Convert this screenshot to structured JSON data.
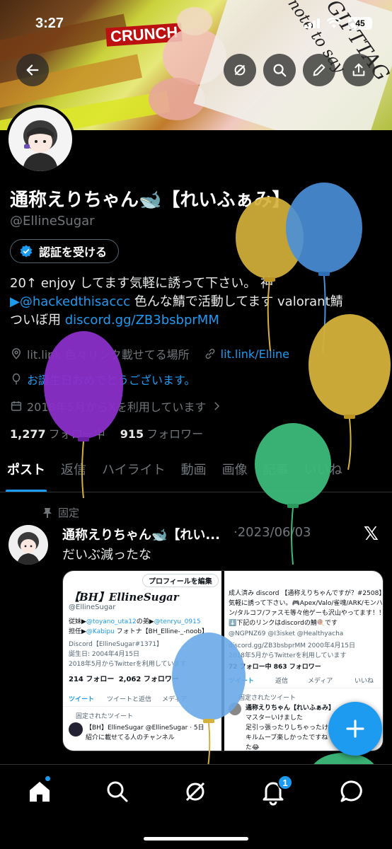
{
  "status_bar": {
    "time": "3:27",
    "battery": "45"
  },
  "profile": {
    "display_name": "通称えりちゃん🐋【れいふぁみ】",
    "handle": "@EllineSugar",
    "verify_button": "認証を受ける",
    "bio_line1": "20↑ enjoy してます気軽に誘って下さい。 神",
    "bio_line2_link": "▶@hackedthisaccc",
    "bio_line2_text": " 色んな鯖で活動してます valorant鯖",
    "bio_line3_text": "ついぼ用 ",
    "bio_line3_link": "discord.gg/ZB3bsbprMM",
    "location": "lit.link 色々リンク載せてる場所",
    "website": "lit.link/Elline",
    "birthday": "お誕生日おめでとうございます。",
    "joined": "2018年5月からXを利用しています",
    "following_count": "1,277",
    "following_label": "フォロー中",
    "followers_count": "915",
    "followers_label": "フォロワー"
  },
  "tabs": [
    "ポスト",
    "返信",
    "ハイライト",
    "動画",
    "画像",
    "記事",
    "いいね"
  ],
  "pinned_tweet": {
    "pinned_label": "固定",
    "author": "通称えりちゃん🐋【れい...",
    "date": "·2023/06/03",
    "text": "だいぶ減ったな",
    "left_shot": {
      "edit_button": "プロフィールを編集",
      "name": "【BH】EllineSugar",
      "handle": "@EllineSugar",
      "line1a": "従妹▶",
      "line1b": "@toyano_uta12",
      "line1c": "の弟▶",
      "line1d": "@tenryu_0915",
      "line2a": "担任▶",
      "line2b": "@Kabipu",
      "line2c": " フォトナ【BH_Elline-_-noob】",
      "line3": "Discord【EllineSugar#1371】",
      "line4": "誕生日: 2004年4月15日",
      "line5": "2018年5月からTwitterを利用しています",
      "following": "214 フォロー",
      "followers": "2,062 フォロワー",
      "tab1": "ツイート",
      "tab2": "ツイートと返信",
      "tab3": "メディア",
      "pinned": "固定されたツイート",
      "tweet_author": "【BH】EllineSugar @EllineSugar · 5日",
      "tweet_text": "紹介に載せてる人のチャンネル"
    },
    "right_shot": {
      "line1": "成人済み discord 【通称えりちゃんですが？#2508】",
      "line2": "気軽に誘って下さい。🎮Apex/Valo/雀魂/ARK/モンハ",
      "line3": "ン/タルコフ/ファスモ等々他ゲーも沢山やってます！！",
      "line4": "⬇️下記のリンクはdiscordの鯖🍭です",
      "line5": "@NGPNZ69  @I3isket  @Healthyacha",
      "line6": "discord.gg/ZB3bsbprMM   2000年4月15日",
      "line7": "2018年5月からTwitterを利用しています",
      "following": "72 フォロー中  863 フォロワー",
      "tab1": "ツイート",
      "tab2": "返信",
      "tab3": "メディア",
      "tab4": "いいね",
      "pinned": "固定されたツイート",
      "tweet_author": "通称えりちゃん【れいふぁみ】",
      "tweet_l1": "マスターいけました",
      "tweet_l2": "足引っ張ったりしちゃったけど",
      "tweet_l3": "キルムーブ楽しかったですね",
      "tweet_l4": "た😂"
    }
  },
  "bottom_nav": {
    "notification_badge": "1"
  },
  "colors": {
    "accent": "#1d9bf0",
    "balloon_yellow": "#d4b13a",
    "balloon_blue": "#4a90d9",
    "balloon_purple": "#8a2fc9",
    "balloon_green": "#3cba7a"
  }
}
